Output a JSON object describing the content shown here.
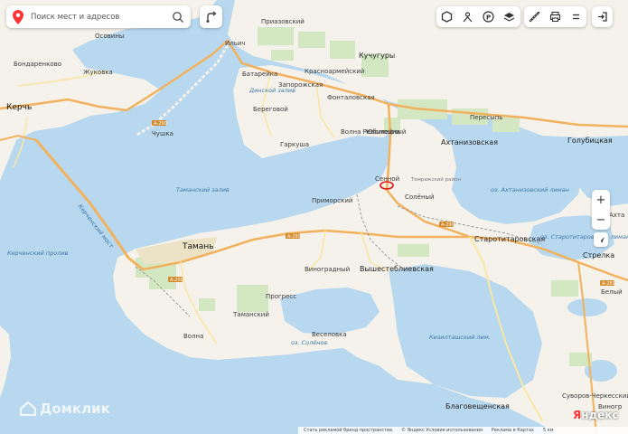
{
  "search": {
    "placeholder": "Поиск мест и адресов"
  },
  "colors": {
    "water": "#b7d8ef",
    "land": "#f4f2ea",
    "field": "#d3e7c2",
    "road_orange": "#f2b25d",
    "road_yellow": "#fae7a5",
    "marker": "#e01414"
  },
  "icons": {
    "search": "pin-icon",
    "route": "route-icon",
    "toolbar_left": [
      "layers-icon",
      "traffic-icon",
      "parking-icon",
      "stack-icon"
    ],
    "toolbar_right": [
      "ruler-icon",
      "print-icon",
      "menu-icon"
    ],
    "login": "login-icon"
  },
  "places": {
    "priozovsky": "Приазовский",
    "ilich": "Ильич",
    "kuchuguri": "Кучугуры",
    "krasnoarmeisky": "Красноармейский",
    "batareika": "Батарейка",
    "zaporozhskaya": "Запорожская",
    "fontalovskaya": "Фонталовская",
    "beregovoy": "Береговой",
    "volna_revolutsii": "Волна Революции",
    "yubileiny": "Юбилейный",
    "garkusha": "Гаркуша",
    "peresyp": "Пересыпь",
    "akhtanizovskaya": "Ахтанизовская",
    "golubitskaya": "Голубицкая",
    "osovinsy": "Осовины",
    "bondarenkovo": "Бондаренково",
    "zhukovka": "Жуковка",
    "kerch": "Керчь",
    "chushka": "Чушка",
    "sennoy": "Сенной",
    "solyony": "Солёный",
    "primorsky": "Приморский",
    "taman": "Тамань",
    "starotitarovskaya": "Старотитаровская",
    "strelka": "Стрелка",
    "vinogradny": "Виноградный",
    "vyshesteblievskaya": "Вышестеблиевская",
    "progress": "Прогресс",
    "tamansky": "Таманский",
    "veselovka": "Веселовка",
    "volna": "Волна",
    "blagoveshchenskaya": "Благовещенская",
    "suvorov_cherkessky": "Суворов-Черкесский",
    "vinogr": "Виногр",
    "belyi": "Белый",
    "akhta": "Ахта"
  },
  "water_labels": {
    "dinskoy": "Динской залив",
    "tamansky_zaliv": "Таманский залив",
    "kerchensky_proliv": "Керченский пролив",
    "kerchensky_bridge": "Керченский мост",
    "akhtanizovsky_liman": "оз. Ахтанизовский лиман",
    "starotitarovsky_liman": "оз. Старотитаровский лиман",
    "solyonoe": "оз. Солёное",
    "kiziltashsky_liman": "Кизилташский лим.",
    "temryuk_region": "Темрюкский район",
    "strait_crimea": "Крым"
  },
  "roads": [
    "А-290",
    "А-290",
    "А-290",
    "А-290",
    "Е97 А-290",
    "А-289"
  ],
  "zoom": {
    "plus": "+",
    "minus": "−"
  },
  "watermark": "Домклик",
  "logo": {
    "first": "Я",
    "rest": "ндекс"
  },
  "attribution": {
    "ads": "Стать рекламой бренд пространства",
    "terms": "© Яндекс Условия использования",
    "maps_ads": "Реклама в Картах",
    "scale": "5 км"
  }
}
